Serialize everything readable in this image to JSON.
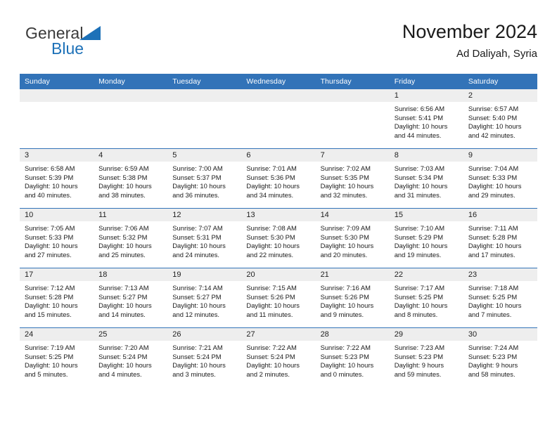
{
  "brand": {
    "name_top": "General",
    "name_bottom": "Blue",
    "triangle_icon": "blue-triangle-icon",
    "colors": {
      "general_text": "#3a3a3a",
      "blue_text": "#1d71b8",
      "triangle": "#1d71b8"
    }
  },
  "header": {
    "title": "November 2024",
    "subtitle": "Ad Daliyah, Syria"
  },
  "theme": {
    "header_blue": "#3273b8",
    "daynum_band": "#eeeeee",
    "cell_background": "#ffffff",
    "text": "#1a1a1a"
  },
  "weekday_headers": [
    "Sunday",
    "Monday",
    "Tuesday",
    "Wednesday",
    "Thursday",
    "Friday",
    "Saturday"
  ],
  "weeks": [
    [
      {
        "day": "",
        "sunrise": "",
        "sunset": "",
        "daylight_line1": "",
        "daylight_line2": "",
        "empty": true
      },
      {
        "day": "",
        "sunrise": "",
        "sunset": "",
        "daylight_line1": "",
        "daylight_line2": "",
        "empty": true
      },
      {
        "day": "",
        "sunrise": "",
        "sunset": "",
        "daylight_line1": "",
        "daylight_line2": "",
        "empty": true
      },
      {
        "day": "",
        "sunrise": "",
        "sunset": "",
        "daylight_line1": "",
        "daylight_line2": "",
        "empty": true
      },
      {
        "day": "",
        "sunrise": "",
        "sunset": "",
        "daylight_line1": "",
        "daylight_line2": "",
        "empty": true
      },
      {
        "day": "1",
        "sunrise": "Sunrise: 6:56 AM",
        "sunset": "Sunset: 5:41 PM",
        "daylight_line1": "Daylight: 10 hours",
        "daylight_line2": "and 44 minutes."
      },
      {
        "day": "2",
        "sunrise": "Sunrise: 6:57 AM",
        "sunset": "Sunset: 5:40 PM",
        "daylight_line1": "Daylight: 10 hours",
        "daylight_line2": "and 42 minutes."
      }
    ],
    [
      {
        "day": "3",
        "sunrise": "Sunrise: 6:58 AM",
        "sunset": "Sunset: 5:39 PM",
        "daylight_line1": "Daylight: 10 hours",
        "daylight_line2": "and 40 minutes."
      },
      {
        "day": "4",
        "sunrise": "Sunrise: 6:59 AM",
        "sunset": "Sunset: 5:38 PM",
        "daylight_line1": "Daylight: 10 hours",
        "daylight_line2": "and 38 minutes."
      },
      {
        "day": "5",
        "sunrise": "Sunrise: 7:00 AM",
        "sunset": "Sunset: 5:37 PM",
        "daylight_line1": "Daylight: 10 hours",
        "daylight_line2": "and 36 minutes."
      },
      {
        "day": "6",
        "sunrise": "Sunrise: 7:01 AM",
        "sunset": "Sunset: 5:36 PM",
        "daylight_line1": "Daylight: 10 hours",
        "daylight_line2": "and 34 minutes."
      },
      {
        "day": "7",
        "sunrise": "Sunrise: 7:02 AM",
        "sunset": "Sunset: 5:35 PM",
        "daylight_line1": "Daylight: 10 hours",
        "daylight_line2": "and 32 minutes."
      },
      {
        "day": "8",
        "sunrise": "Sunrise: 7:03 AM",
        "sunset": "Sunset: 5:34 PM",
        "daylight_line1": "Daylight: 10 hours",
        "daylight_line2": "and 31 minutes."
      },
      {
        "day": "9",
        "sunrise": "Sunrise: 7:04 AM",
        "sunset": "Sunset: 5:33 PM",
        "daylight_line1": "Daylight: 10 hours",
        "daylight_line2": "and 29 minutes."
      }
    ],
    [
      {
        "day": "10",
        "sunrise": "Sunrise: 7:05 AM",
        "sunset": "Sunset: 5:33 PM",
        "daylight_line1": "Daylight: 10 hours",
        "daylight_line2": "and 27 minutes."
      },
      {
        "day": "11",
        "sunrise": "Sunrise: 7:06 AM",
        "sunset": "Sunset: 5:32 PM",
        "daylight_line1": "Daylight: 10 hours",
        "daylight_line2": "and 25 minutes."
      },
      {
        "day": "12",
        "sunrise": "Sunrise: 7:07 AM",
        "sunset": "Sunset: 5:31 PM",
        "daylight_line1": "Daylight: 10 hours",
        "daylight_line2": "and 24 minutes."
      },
      {
        "day": "13",
        "sunrise": "Sunrise: 7:08 AM",
        "sunset": "Sunset: 5:30 PM",
        "daylight_line1": "Daylight: 10 hours",
        "daylight_line2": "and 22 minutes."
      },
      {
        "day": "14",
        "sunrise": "Sunrise: 7:09 AM",
        "sunset": "Sunset: 5:30 PM",
        "daylight_line1": "Daylight: 10 hours",
        "daylight_line2": "and 20 minutes."
      },
      {
        "day": "15",
        "sunrise": "Sunrise: 7:10 AM",
        "sunset": "Sunset: 5:29 PM",
        "daylight_line1": "Daylight: 10 hours",
        "daylight_line2": "and 19 minutes."
      },
      {
        "day": "16",
        "sunrise": "Sunrise: 7:11 AM",
        "sunset": "Sunset: 5:28 PM",
        "daylight_line1": "Daylight: 10 hours",
        "daylight_line2": "and 17 minutes."
      }
    ],
    [
      {
        "day": "17",
        "sunrise": "Sunrise: 7:12 AM",
        "sunset": "Sunset: 5:28 PM",
        "daylight_line1": "Daylight: 10 hours",
        "daylight_line2": "and 15 minutes."
      },
      {
        "day": "18",
        "sunrise": "Sunrise: 7:13 AM",
        "sunset": "Sunset: 5:27 PM",
        "daylight_line1": "Daylight: 10 hours",
        "daylight_line2": "and 14 minutes."
      },
      {
        "day": "19",
        "sunrise": "Sunrise: 7:14 AM",
        "sunset": "Sunset: 5:27 PM",
        "daylight_line1": "Daylight: 10 hours",
        "daylight_line2": "and 12 minutes."
      },
      {
        "day": "20",
        "sunrise": "Sunrise: 7:15 AM",
        "sunset": "Sunset: 5:26 PM",
        "daylight_line1": "Daylight: 10 hours",
        "daylight_line2": "and 11 minutes."
      },
      {
        "day": "21",
        "sunrise": "Sunrise: 7:16 AM",
        "sunset": "Sunset: 5:26 PM",
        "daylight_line1": "Daylight: 10 hours",
        "daylight_line2": "and 9 minutes."
      },
      {
        "day": "22",
        "sunrise": "Sunrise: 7:17 AM",
        "sunset": "Sunset: 5:25 PM",
        "daylight_line1": "Daylight: 10 hours",
        "daylight_line2": "and 8 minutes."
      },
      {
        "day": "23",
        "sunrise": "Sunrise: 7:18 AM",
        "sunset": "Sunset: 5:25 PM",
        "daylight_line1": "Daylight: 10 hours",
        "daylight_line2": "and 7 minutes."
      }
    ],
    [
      {
        "day": "24",
        "sunrise": "Sunrise: 7:19 AM",
        "sunset": "Sunset: 5:25 PM",
        "daylight_line1": "Daylight: 10 hours",
        "daylight_line2": "and 5 minutes."
      },
      {
        "day": "25",
        "sunrise": "Sunrise: 7:20 AM",
        "sunset": "Sunset: 5:24 PM",
        "daylight_line1": "Daylight: 10 hours",
        "daylight_line2": "and 4 minutes."
      },
      {
        "day": "26",
        "sunrise": "Sunrise: 7:21 AM",
        "sunset": "Sunset: 5:24 PM",
        "daylight_line1": "Daylight: 10 hours",
        "daylight_line2": "and 3 minutes."
      },
      {
        "day": "27",
        "sunrise": "Sunrise: 7:22 AM",
        "sunset": "Sunset: 5:24 PM",
        "daylight_line1": "Daylight: 10 hours",
        "daylight_line2": "and 2 minutes."
      },
      {
        "day": "28",
        "sunrise": "Sunrise: 7:22 AM",
        "sunset": "Sunset: 5:23 PM",
        "daylight_line1": "Daylight: 10 hours",
        "daylight_line2": "and 0 minutes."
      },
      {
        "day": "29",
        "sunrise": "Sunrise: 7:23 AM",
        "sunset": "Sunset: 5:23 PM",
        "daylight_line1": "Daylight: 9 hours",
        "daylight_line2": "and 59 minutes."
      },
      {
        "day": "30",
        "sunrise": "Sunrise: 7:24 AM",
        "sunset": "Sunset: 5:23 PM",
        "daylight_line1": "Daylight: 9 hours",
        "daylight_line2": "and 58 minutes."
      }
    ]
  ]
}
